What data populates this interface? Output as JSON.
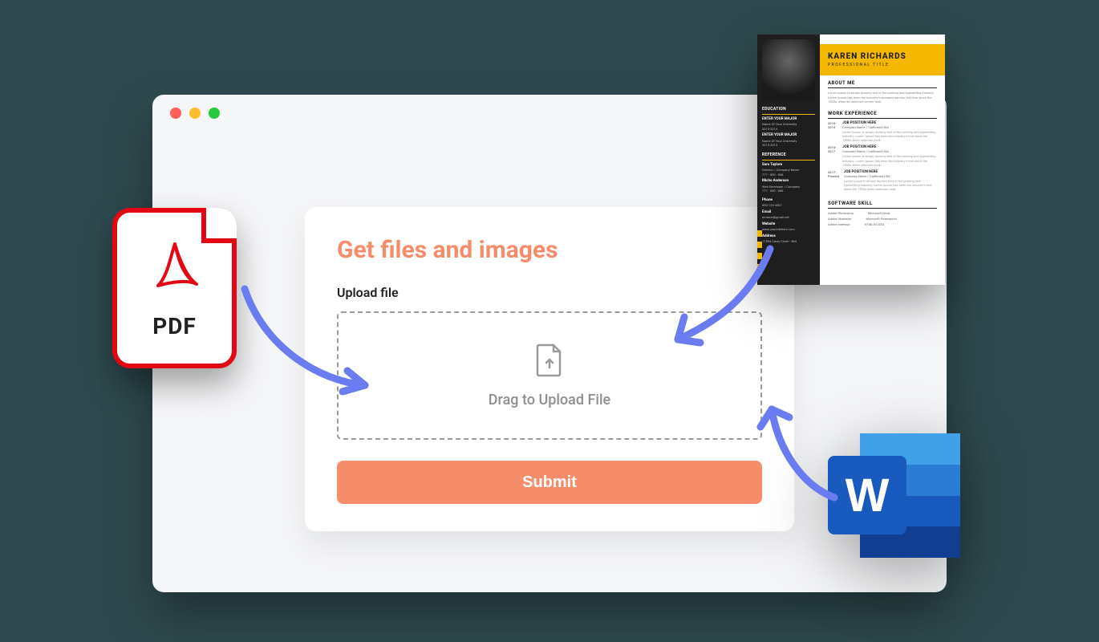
{
  "window": {
    "traffic_lights": [
      "red",
      "yellow",
      "green"
    ]
  },
  "card": {
    "title": "Get files and images",
    "upload_label": "Upload file",
    "dropzone_text": "Drag to Upload File",
    "submit_label": "Submit"
  },
  "pdf_tile": {
    "label": "PDF"
  },
  "word_tile": {
    "letter": "W"
  },
  "resume": {
    "name": "KAREN RICHARDS",
    "title": "PROFESSIONAL TITLE",
    "left": {
      "education_heading": "EDUCATION",
      "education": [
        {
          "degree": "ENTER YOUR MAJOR",
          "school": "Name Of Your University",
          "years": "2010-2014"
        },
        {
          "degree": "ENTER YOUR MAJOR",
          "school": "Name Of Your University",
          "years": "2010-2014"
        }
      ],
      "reference_heading": "REFERENCE",
      "references": [
        {
          "name": "Sara Taylore",
          "role": "Director / Company Name",
          "phone": "777 - 000 - 888"
        },
        {
          "name": "Micho Anderson",
          "role": "Web Developer / Company",
          "phone": "777 - 000 - 888"
        }
      ],
      "contact": {
        "phone_label": "Phone",
        "phone": "000-123-4567",
        "email_label": "Email",
        "email": "urname@gmail.net",
        "website_label": "Website",
        "website": "www.yoursitehere.com",
        "address_label": "Address",
        "address": "11504 Carey Circle - NM"
      }
    },
    "right": {
      "about_heading": "ABOUT ME",
      "about_text": "Lorem ipsum is simply dummy text of the printing and typesetting industry. Lorem ipsum has been the industry's standard dummy text ever since the 1500s, when an unknown printer took.",
      "work_heading": "WORK EXPERIENCE",
      "work": [
        {
          "dates": "2010-2014",
          "position": "JOB POSITION HERE",
          "company": "Company Name / California USA",
          "desc": "Lorem ipsum is simply dummy text of the printing and typesetting industry. Lorem ipsum has been the industry's text since the 1500s when unknown took."
        },
        {
          "dates": "2014-2017",
          "position": "JOB POSITION HERE",
          "company": "Company Name / California USA",
          "desc": "Lorem ipsum is simply dummy text of the printing and typesetting industry. Lorem ipsum has been the industry's text since the 1500s when unknown took."
        },
        {
          "dates": "2017-Present",
          "position": "JOB POSITION HERE",
          "company": "Company Name / California USA",
          "desc": "Lorem ipsum is simply dummy text of the printing and typesetting industry. Lorem ipsum has been the industry's text since the 1500s when unknown took."
        }
      ],
      "skills_heading": "SOFTWARE SKILL",
      "skills": [
        [
          "Adobe Photoshop",
          "Microsoft Word"
        ],
        [
          "Adobe Illustrator",
          "Microsoft Powerpoint"
        ],
        [
          "Adobe Indesign",
          "HTML5/CSS3"
        ]
      ]
    }
  }
}
